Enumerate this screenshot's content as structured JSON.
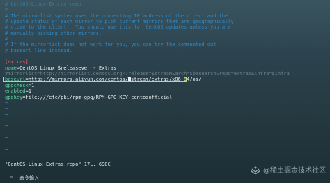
{
  "editor": {
    "lines": [
      {
        "kind": "comment-faint",
        "text": "# CentOS-Linux-Extras.repo"
      },
      {
        "kind": "comment-faint",
        "text": "#"
      },
      {
        "kind": "comment",
        "text": "# The mirrorlist system uses the connecting IP address of the client and the"
      },
      {
        "kind": "comment",
        "text": "# update status of each mirror to pick current mirrors that are geographically"
      },
      {
        "kind": "comment",
        "text": "# close to the client.  You should use this for CentOS updates unless you are"
      },
      {
        "kind": "comment",
        "text": "# manually picking other mirrors."
      },
      {
        "kind": "comment",
        "text": "#"
      },
      {
        "kind": "comment",
        "text": "# If the mirrorlist does not work for you, you can try the commented out"
      },
      {
        "kind": "comment",
        "text": "# baseurl line instead."
      },
      {
        "kind": "blank",
        "text": ""
      },
      {
        "kind": "section",
        "text": "[extras]"
      },
      {
        "kind": "keyval",
        "key": "name",
        "value": "CentOS Linux $releasever - Extras"
      },
      {
        "kind": "blur",
        "text": "#mirrorlist=http://mirrorlist.centos.org/?release=$stream&arch=$basearch&repo=extras&infra=$infra"
      },
      {
        "kind": "highlight",
        "key": "baseurl",
        "value": "https://mirrors.aliyun.com/centos/",
        "tail": "stream/extras/x86_64/os/"
      },
      {
        "kind": "keyval",
        "key": "gpgcheck",
        "value": "1"
      },
      {
        "kind": "keyval",
        "key": "enabled",
        "value": "1"
      },
      {
        "kind": "keyval",
        "key": "gpgkey",
        "value": "file:///etc/pki/rpm-gpg/RPM-GPG-KEY-centosofficial"
      },
      {
        "kind": "tilde",
        "text": "~"
      },
      {
        "kind": "tilde",
        "text": "~"
      },
      {
        "kind": "tilde",
        "text": "~"
      },
      {
        "kind": "tilde",
        "text": "~"
      },
      {
        "kind": "tilde",
        "text": "~"
      },
      {
        "kind": "tilde",
        "text": "~"
      },
      {
        "kind": "tilde",
        "text": "~"
      },
      {
        "kind": "tilde",
        "text": "~"
      },
      {
        "kind": "tilde",
        "text": "~"
      }
    ]
  },
  "status": {
    "file_info": "\"CentOS-Linux-Extras.repo\" 17L, 698C",
    "icon": "terminal-icon",
    "command_label": "命令输入"
  },
  "watermark": {
    "text": "@稀土掘金技术社区"
  },
  "colors": {
    "comment": "#2f9be6",
    "section": "#ff5a5a",
    "key": "#5fd4a0",
    "highlight_box": "#c9e03a",
    "tilde": "#3d8fd8"
  }
}
